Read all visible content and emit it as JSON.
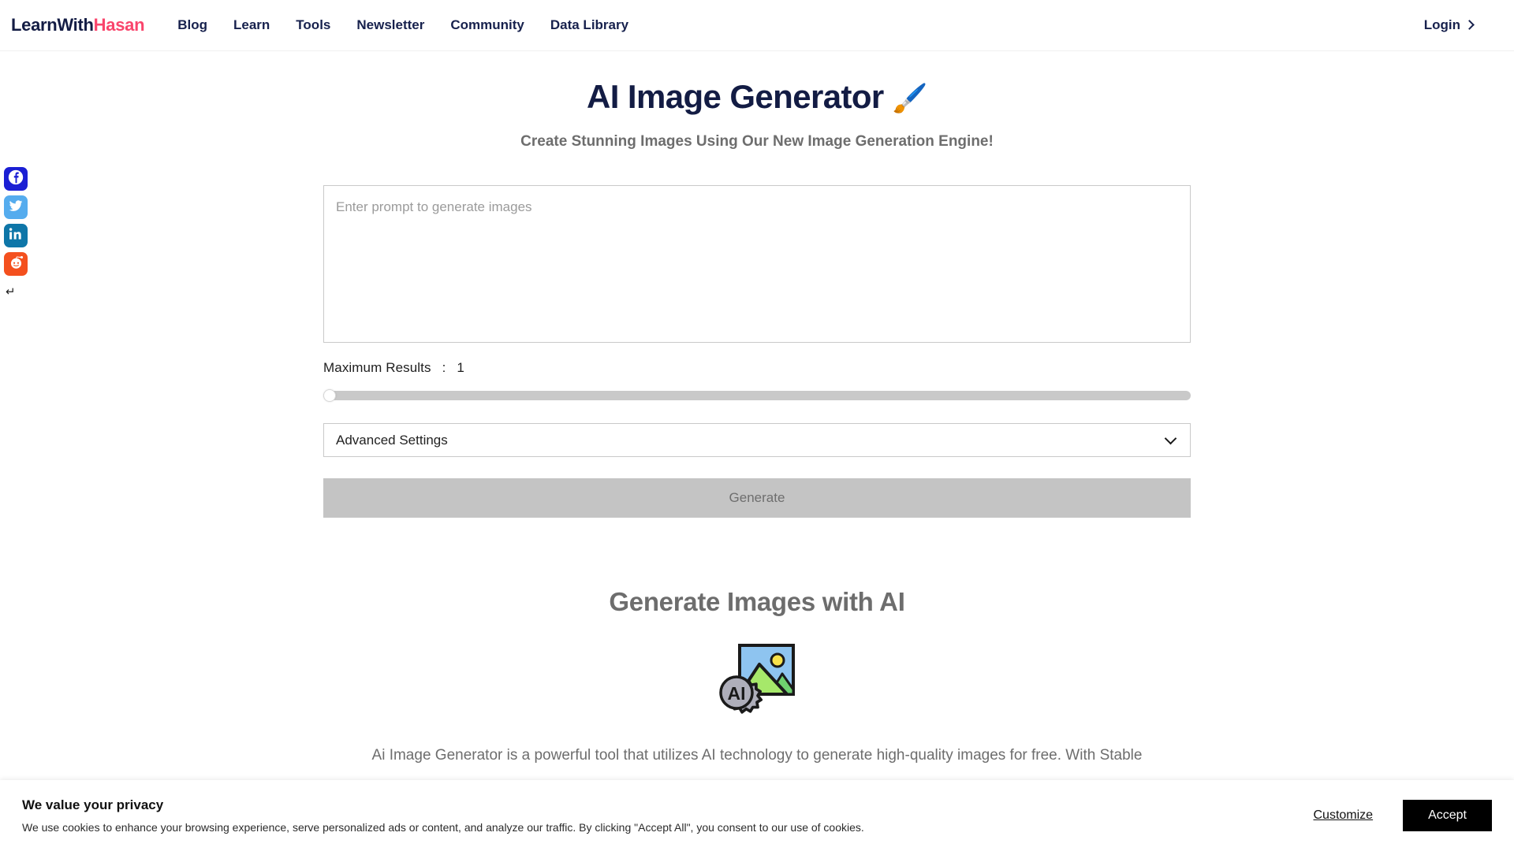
{
  "nav": {
    "brand_part1": "LearnWith",
    "brand_part2": "Hasan",
    "links": [
      {
        "label": "Blog"
      },
      {
        "label": "Learn"
      },
      {
        "label": "Tools"
      },
      {
        "label": "Newsletter"
      },
      {
        "label": "Community"
      },
      {
        "label": "Data Library"
      }
    ],
    "login_label": "Login"
  },
  "social": {
    "items": [
      {
        "name": "facebook",
        "color": "#1b1fd4"
      },
      {
        "name": "twitter",
        "color": "#55acee"
      },
      {
        "name": "linkedin",
        "color": "#0e76a8"
      },
      {
        "name": "reddit",
        "color": "#f4501e"
      }
    ],
    "collapse_glyph": "↵"
  },
  "hero": {
    "title": "AI Image Generator",
    "title_emoji": "🖌️",
    "subtitle": "Create Stunning Images Using Our New Image Generation Engine!"
  },
  "form": {
    "prompt_placeholder": "Enter prompt to generate images",
    "prompt_value": "",
    "max_results_label": "Maximum Results",
    "max_results_separator": ":",
    "max_results_value": "1",
    "slider_min": "1",
    "slider_max": "10",
    "slider_position_percent": 0,
    "advanced_settings_label": "Advanced Settings",
    "generate_label": "Generate",
    "generate_disabled": true
  },
  "info": {
    "section_title": "Generate Images with AI",
    "body": "Ai Image Generator is a powerful tool that utilizes AI technology to generate high-quality images for free. With Stable"
  },
  "cookie": {
    "title": "We value your privacy",
    "description": "We use cookies to enhance your browsing experience, serve personalized ads or content, and analyze our traffic. By clicking \"Accept All\", you consent to our use of cookies.",
    "customize_label": "Customize",
    "accept_label": "Accept"
  },
  "colors": {
    "brand_dark": "#131c44",
    "brand_pink": "#f9456c",
    "nav_text": "#17214d",
    "muted_text": "#6d6d6d",
    "disabled_button": "#c4c4c4",
    "accept_button": "#000000"
  }
}
